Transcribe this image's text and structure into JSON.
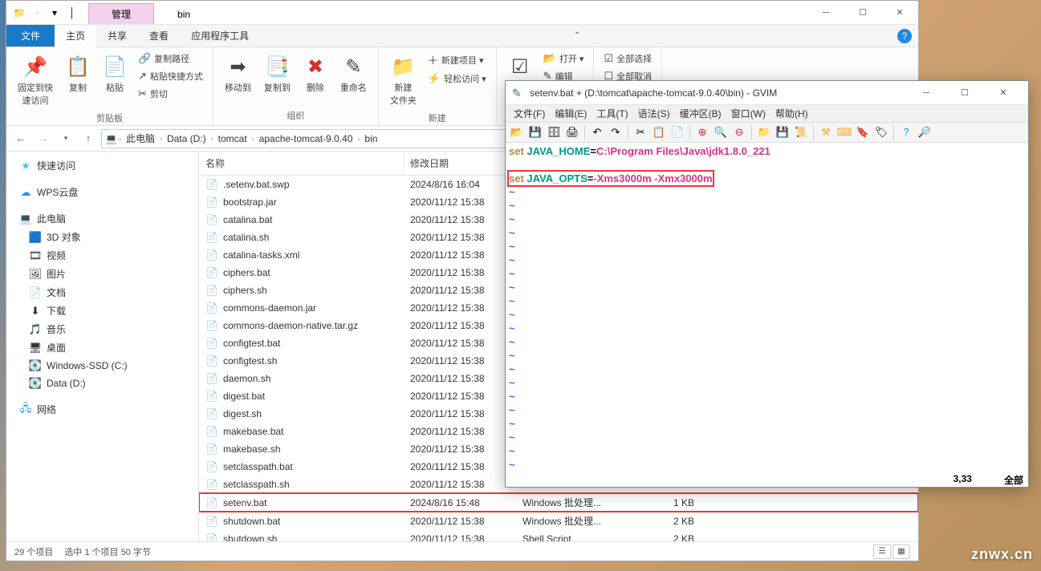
{
  "explorer": {
    "titlebar": {
      "tab_manage": "管理",
      "tab_bin": "bin"
    },
    "tabs": {
      "file": "文件",
      "home": "主页",
      "share": "共享",
      "view": "查看",
      "tools": "应用程序工具"
    },
    "ribbon": {
      "pin": "固定到快\n速访问",
      "copy": "复制",
      "paste": "粘贴",
      "copy_path": "复制路径",
      "paste_shortcut": "粘贴快捷方式",
      "cut": "剪切",
      "clipboard_label": "剪贴板",
      "move_to": "移动到",
      "copy_to": "复制到",
      "delete": "删除",
      "rename": "重命名",
      "organize_label": "组织",
      "new_folder": "新建\n文件夹",
      "new_item": "新建项目 ▾",
      "easy_access": "轻松访问 ▾",
      "new_label": "新建",
      "properties": "属性",
      "open": "打开 ▾",
      "edit": "编辑",
      "select_all": "全部选择",
      "select_none": "全部取消"
    },
    "breadcrumb": [
      "此电脑",
      "Data (D:)",
      "tomcat",
      "apache-tomcat-9.0.40",
      "bin"
    ],
    "sidebar": {
      "quick": "快速访问",
      "wps": "WPS云盘",
      "thispc": "此电脑",
      "items": [
        "3D 对象",
        "视频",
        "图片",
        "文档",
        "下载",
        "音乐",
        "桌面",
        "Windows-SSD (C:)",
        "Data (D:)"
      ],
      "network": "网络"
    },
    "cols": {
      "name": "名称",
      "date": "修改日期",
      "type": "类型",
      "size": "大小"
    },
    "files": [
      {
        "name": ".setenv.bat.swp",
        "date": "2024/8/16 16:04",
        "type": "",
        "size": ""
      },
      {
        "name": "bootstrap.jar",
        "date": "2020/11/12 15:38",
        "type": "",
        "size": ""
      },
      {
        "name": "catalina.bat",
        "date": "2020/11/12 15:38",
        "type": "",
        "size": ""
      },
      {
        "name": "catalina.sh",
        "date": "2020/11/12 15:38",
        "type": "",
        "size": ""
      },
      {
        "name": "catalina-tasks.xml",
        "date": "2020/11/12 15:38",
        "type": "",
        "size": ""
      },
      {
        "name": "ciphers.bat",
        "date": "2020/11/12 15:38",
        "type": "",
        "size": ""
      },
      {
        "name": "ciphers.sh",
        "date": "2020/11/12 15:38",
        "type": "",
        "size": ""
      },
      {
        "name": "commons-daemon.jar",
        "date": "2020/11/12 15:38",
        "type": "",
        "size": ""
      },
      {
        "name": "commons-daemon-native.tar.gz",
        "date": "2020/11/12 15:38",
        "type": "",
        "size": ""
      },
      {
        "name": "configtest.bat",
        "date": "2020/11/12 15:38",
        "type": "",
        "size": ""
      },
      {
        "name": "configtest.sh",
        "date": "2020/11/12 15:38",
        "type": "",
        "size": ""
      },
      {
        "name": "daemon.sh",
        "date": "2020/11/12 15:38",
        "type": "",
        "size": ""
      },
      {
        "name": "digest.bat",
        "date": "2020/11/12 15:38",
        "type": "",
        "size": ""
      },
      {
        "name": "digest.sh",
        "date": "2020/11/12 15:38",
        "type": "",
        "size": ""
      },
      {
        "name": "makebase.bat",
        "date": "2020/11/12 15:38",
        "type": "",
        "size": ""
      },
      {
        "name": "makebase.sh",
        "date": "2020/11/12 15:38",
        "type": "",
        "size": ""
      },
      {
        "name": "setclasspath.bat",
        "date": "2020/11/12 15:38",
        "type": "",
        "size": ""
      },
      {
        "name": "setclasspath.sh",
        "date": "2020/11/12 15:38",
        "type": "",
        "size": ""
      },
      {
        "name": "setenv.bat",
        "date": "2024/8/16 15:48",
        "type": "Windows 批处理...",
        "size": "1 KB",
        "selected": true
      },
      {
        "name": "shutdown.bat",
        "date": "2020/11/12 15:38",
        "type": "Windows 批处理...",
        "size": "2 KB"
      },
      {
        "name": "shutdown.sh",
        "date": "2020/11/12 15:38",
        "type": "Shell Script",
        "size": "2 KB"
      }
    ],
    "status": {
      "count": "29 个项目",
      "selected": "选中 1 个项目  50 字节"
    }
  },
  "gvim": {
    "title": "setenv.bat + (D:\\tomcat\\apache-tomcat-9.0.40\\bin) - GVIM",
    "menus": [
      "文件(F)",
      "编辑(E)",
      "工具(T)",
      "语法(S)",
      "缓冲区(B)",
      "窗口(W)",
      "帮助(H)"
    ],
    "line1": {
      "set": "set ",
      "var": "JAVA_HOME",
      "eq": "=",
      "val": "C:\\Program Files\\Java\\jdk1.8.0_221"
    },
    "line2": {
      "set": "set ",
      "var": "JAVA_OPTS",
      "eq": "=",
      "val": "-Xms3000m -Xmx3000m"
    },
    "status": {
      "pos": "3,33",
      "all": "全部"
    }
  },
  "watermark": "znwx.cn"
}
